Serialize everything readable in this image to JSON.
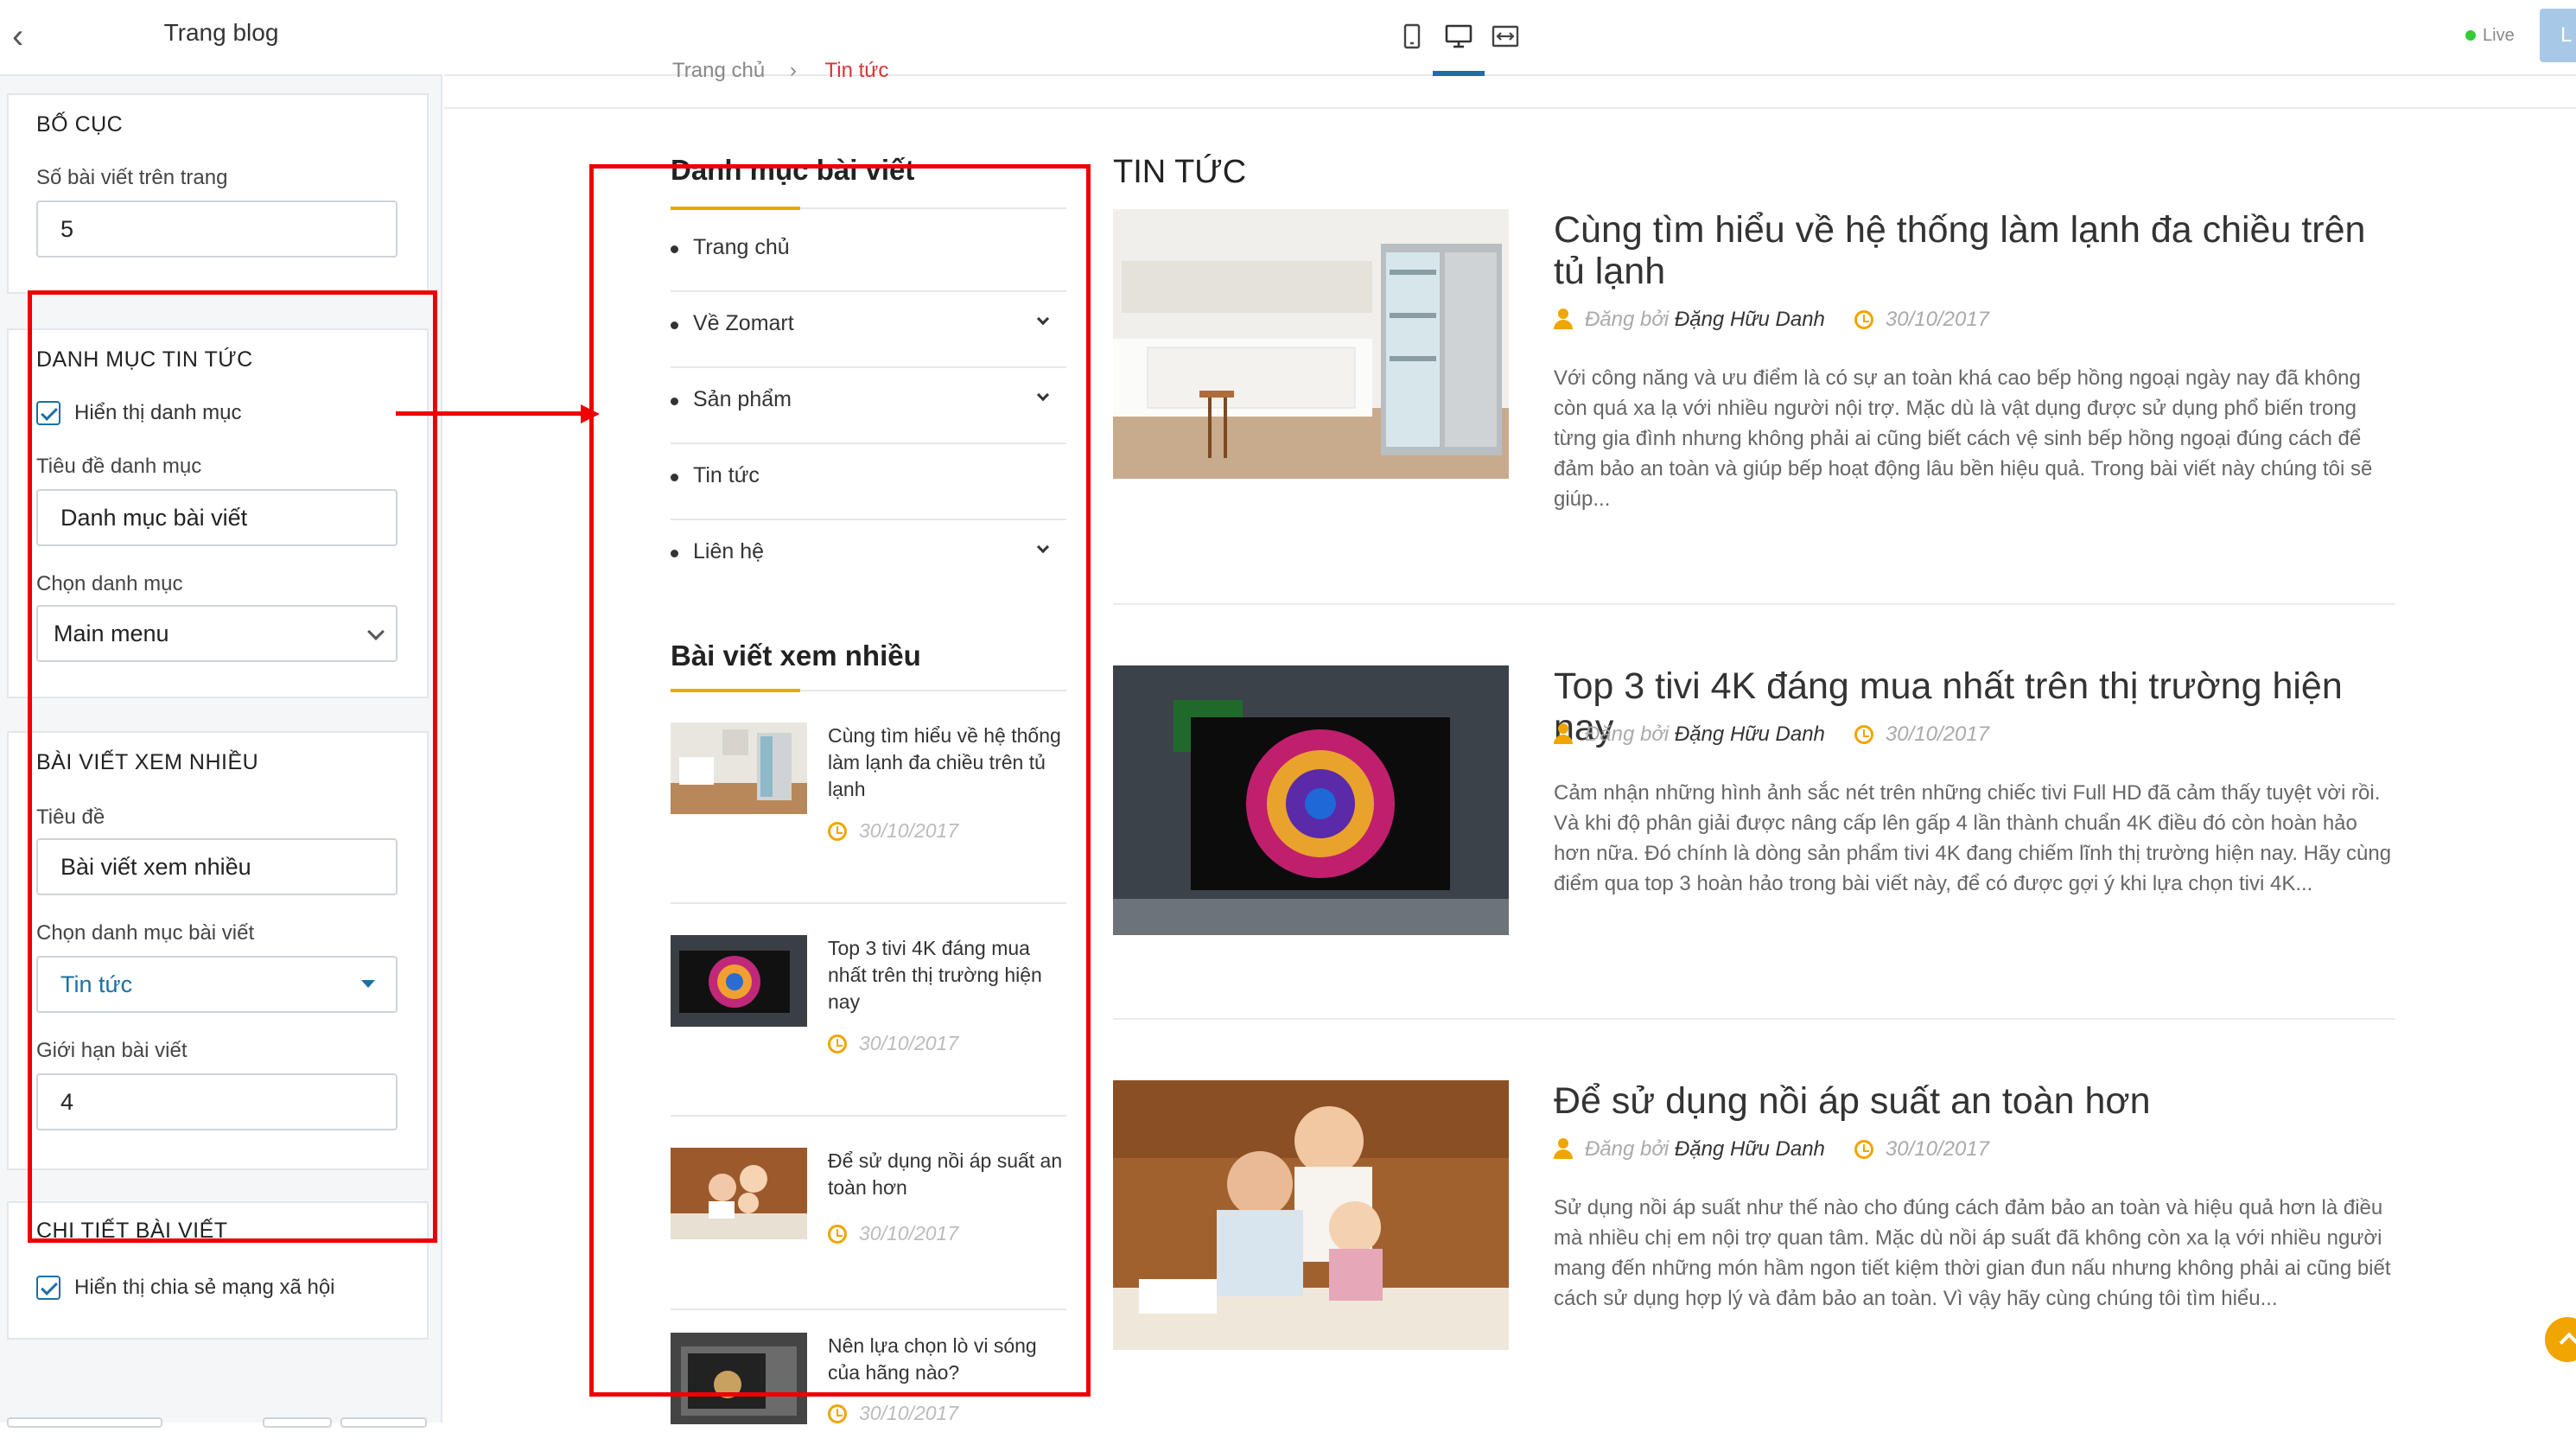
{
  "sidebar": {
    "title": "Trang blog",
    "layout": {
      "heading": "BỐ CỤC",
      "posts_label": "Số bài viết trên trang",
      "posts_value": "5"
    },
    "category": {
      "heading": "DANH MỤC TIN TỨC",
      "show_label": "Hiển thị danh mục",
      "show_checked": true,
      "title_label": "Tiêu đề danh mục",
      "title_value": "Danh mục bài viết",
      "select_label": "Chọn danh mục",
      "select_value": "Main menu"
    },
    "popular": {
      "heading": "BÀI VIẾT XEM NHIỀU",
      "title_label": "Tiêu đề",
      "title_value": "Bài viết xem nhiều",
      "select_label": "Chọn danh mục bài viết",
      "select_value": "Tin tức",
      "limit_label": "Giới hạn bài viết",
      "limit_value": "4"
    },
    "detail": {
      "heading": "CHI TIẾT BÀI VIẾT",
      "share_label": "Hiển thị chia sẻ mạng xã hội",
      "share_checked": true
    }
  },
  "topbar": {
    "live_label": "Live",
    "button_label": "L",
    "view_icons": [
      "mobile-view-icon",
      "desktop-view-icon",
      "fullwidth-view-icon"
    ],
    "active_view": "desktop-view-icon"
  },
  "breadcrumb": {
    "home": "Trang chủ",
    "separator": "›",
    "current": "Tin tức"
  },
  "categories": {
    "title": "Danh mục bài viết",
    "items": [
      {
        "label": "Trang chủ",
        "has_children": false
      },
      {
        "label": "Về Zomart",
        "has_children": true
      },
      {
        "label": "Sản phẩm",
        "has_children": true
      },
      {
        "label": "Tin tức",
        "has_children": false
      },
      {
        "label": "Liên hệ",
        "has_children": true
      }
    ]
  },
  "popular_posts": {
    "title": "Bài viết xem nhiều",
    "items": [
      {
        "title": "Cùng tìm hiểu về hệ thống làm lạnh đa chiều trên tủ lạnh",
        "date": "30/10/2017"
      },
      {
        "title": "Top 3 tivi 4K đáng mua nhất trên thị trường hiện nay",
        "date": "30/10/2017"
      },
      {
        "title": "Để sử dụng nồi áp suất an toàn hơn",
        "date": "30/10/2017"
      },
      {
        "title": "Nên lựa chọn lò vi sóng của hãng nào?",
        "date": "30/10/2017"
      }
    ]
  },
  "news": {
    "heading": "TIN TỨC",
    "posted_by": "Đăng bởi",
    "articles": [
      {
        "title": "Cùng tìm hiểu về hệ thống làm lạnh đa chiều trên tủ lạnh",
        "author": "Đặng Hữu Danh",
        "date": "30/10/2017",
        "excerpt": "Với công năng và ưu điểm là có sự an toàn khá cao bếp hồng ngoại ngày nay đã không còn quá xa lạ với nhiều người nội trợ. Mặc dù là vật dụng được sử dụng phổ biến trong từng gia đình nhưng không phải ai cũng biết cách vệ sinh bếp hồng ngoại đúng cách để đảm bảo an toàn và giúp bếp hoạt động lâu bền hiệu quả. Trong bài viết này chúng tôi sẽ giúp..."
      },
      {
        "title": "Top 3 tivi 4K đáng mua nhất trên thị trường hiện nay",
        "author": "Đặng Hữu Danh",
        "date": "30/10/2017",
        "excerpt": "Cảm nhận những hình ảnh sắc nét trên những chiếc tivi Full HD đã cảm thấy tuyệt vời rồi. Và khi độ phân giải được nâng cấp lên gấp 4 lần thành chuẩn 4K điều đó còn hoàn hảo hơn nữa. Đó chính là dòng sản phẩm tivi 4K đang chiếm lĩnh thị trường hiện nay. Hãy cùng điểm qua top 3 hoàn hảo trong bài viết này, để có được gợi ý khi lựa chọn tivi 4K..."
      },
      {
        "title": "Để sử dụng nồi áp suất an toàn hơn",
        "author": "Đặng Hữu Danh",
        "date": "30/10/2017",
        "excerpt": "Sử dụng nồi áp suất như thế nào cho đúng cách đảm bảo an toàn và hiệu quả hơn là điều mà nhiều chị em nội trợ quan tâm. Mặc dù nồi áp suất đã không còn xa lạ với nhiều người mang đến những món hầm ngon tiết kiệm thời gian đun nấu nhưng không phải ai cũng biết cách sử dụng hợp lý và đảm bảo an toàn. Vì vậy hãy cùng chúng tôi tìm hiểu..."
      }
    ]
  },
  "colors": {
    "accent": "#1d6fa5",
    "highlight": "#f0a500",
    "annotation": "#e00000"
  }
}
